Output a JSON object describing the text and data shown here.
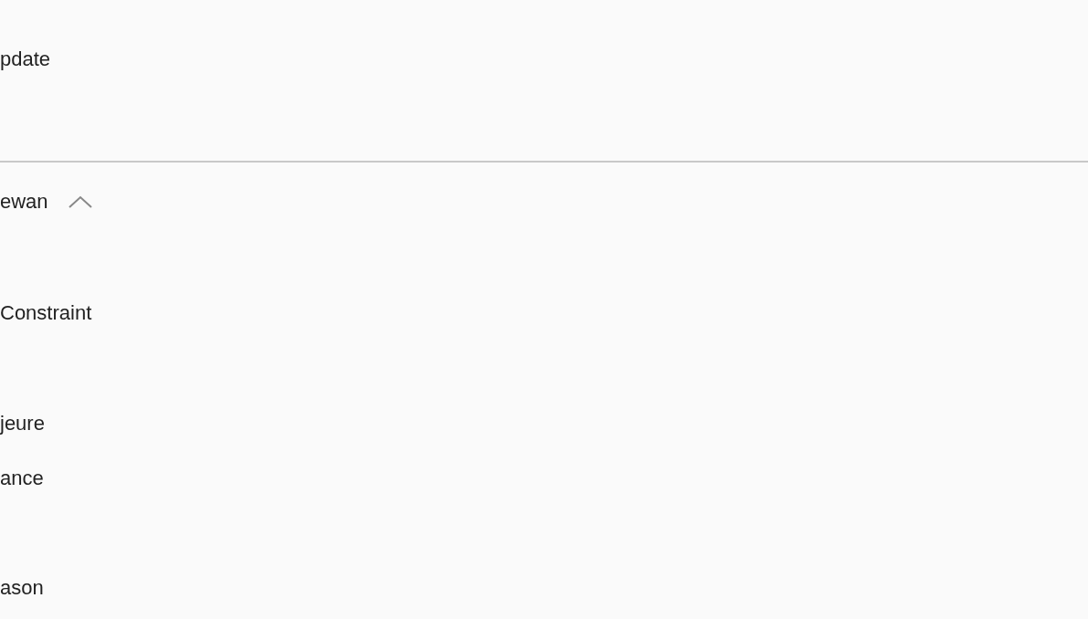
{
  "top_section": {
    "label": "pdate"
  },
  "group": {
    "label": "ewan",
    "expanded": true,
    "items": [
      {
        "label": "Constraint"
      },
      {
        "label": "jeure"
      },
      {
        "label": "ance"
      },
      {
        "label": "ason"
      }
    ]
  }
}
